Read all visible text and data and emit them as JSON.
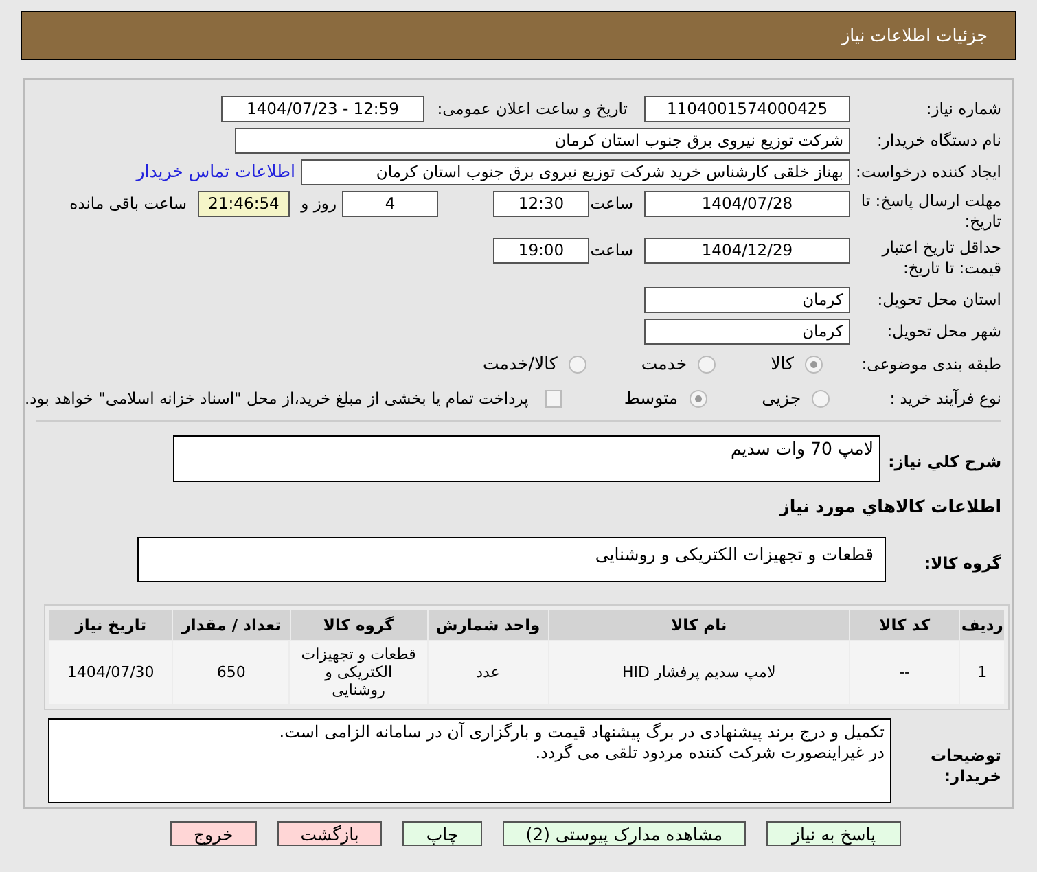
{
  "header": {
    "title": "جزئیات اطلاعات نیاز"
  },
  "need_number": {
    "label": "شماره نیاز:",
    "value": "1104001574000425"
  },
  "announce": {
    "label": "تاریخ و ساعت اعلان عمومی:",
    "value": "1404/07/23 - 12:59"
  },
  "buyer": {
    "label": "نام دستگاه خریدار:",
    "value": "شرکت توزیع نیروی برق جنوب استان کرمان"
  },
  "creator": {
    "label": "ایجاد کننده درخواست:",
    "value": "بهناز خلقی کارشناس خرید شرکت توزیع نیروی برق جنوب استان کرمان",
    "link": "اطلاعات تماس خریدار"
  },
  "deadline": {
    "label": "مهلت ارسال پاسخ: تا تاریخ:",
    "date": "1404/07/28",
    "time_label": "ساعت",
    "time": "12:30",
    "days": "4",
    "days_label": "روز و",
    "remaining": "21:46:54",
    "remaining_label": "ساعت باقی مانده"
  },
  "validity": {
    "label": "حداقل تاریخ اعتبار قیمت: تا تاریخ:",
    "date": "1404/12/29",
    "time_label": "ساعت",
    "time": "19:00"
  },
  "province": {
    "label": "استان محل تحویل:",
    "value": "کرمان"
  },
  "city": {
    "label": "شهر محل تحویل:",
    "value": "کرمان"
  },
  "category": {
    "label": "طبقه بندی موضوعی:",
    "options": [
      {
        "label": "کالا",
        "selected": true
      },
      {
        "label": "خدمت",
        "selected": false
      },
      {
        "label": "کالا/خدمت",
        "selected": false
      }
    ]
  },
  "purchase_type": {
    "label": "نوع فرآیند خرید :",
    "options": [
      {
        "label": "جزیی",
        "selected": false
      },
      {
        "label": "متوسط",
        "selected": true
      }
    ],
    "payment_checkbox": {
      "checked": false,
      "label": "پرداخت تمام یا بخشی از مبلغ خرید،از محل \"اسناد خزانه اسلامی\" خواهد بود."
    }
  },
  "description": {
    "label": "شرح کلي نياز:",
    "value": "لامپ 70 وات سدیم"
  },
  "goods_heading": "اطلاعات کالاهاي مورد نياز",
  "goods_group": {
    "label": "گروه کالا:",
    "value": "قطعات و تجهیزات الکتریکی و روشنایی"
  },
  "table": {
    "columns": [
      "ردیف",
      "کد کالا",
      "نام کالا",
      "واحد شمارش",
      "گروه کالا",
      "تعداد / مقدار",
      "تاریخ نیاز"
    ],
    "rows": [
      [
        "1",
        "--",
        "لامپ سدیم پرفشار HID",
        "عدد",
        "قطعات و تجهیزات الکتریکی و روشنایی",
        "650",
        "1404/07/30"
      ]
    ]
  },
  "buyer_notes": {
    "label": "توضیحات خریدار:",
    "lines": [
      "تکمیل و درج برند پیشنهادی در برگ پیشنهاد قیمت و بارگزاری آن در سامانه الزامی است.",
      "در غیراینصورت شرکت کننده مردود تلقی می گردد."
    ]
  },
  "buttons": [
    {
      "label": "پاسخ به نیاز",
      "kind": "action"
    },
    {
      "label": "مشاهده مدارک پیوستی (2)",
      "kind": "action"
    },
    {
      "label": "چاپ",
      "kind": "action"
    },
    {
      "label": "بازگشت",
      "kind": "danger"
    },
    {
      "label": "خروج",
      "kind": "danger"
    }
  ]
}
